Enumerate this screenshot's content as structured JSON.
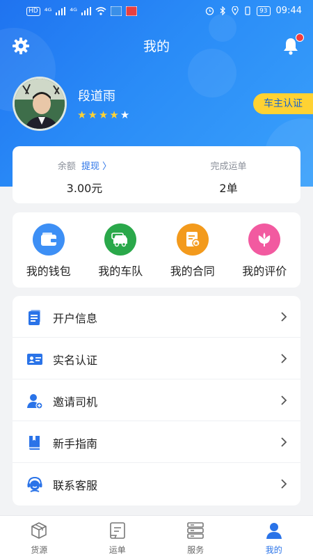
{
  "status_bar": {
    "network_chip": "HD",
    "signal_1": "⁴ᴳ",
    "signal_2": "⁴ᴳ",
    "battery": "93",
    "time": "09:44"
  },
  "header": {
    "title": "我的",
    "user_name": "段道雨",
    "rating_stars": 5,
    "verify_button": "车主认证"
  },
  "stats": {
    "balance_label": "余额",
    "withdraw_link": "提现 〉",
    "balance_value": "3.00元",
    "completed_label": "完成运单",
    "completed_value": "2单"
  },
  "quick_menu": [
    {
      "label": "我的钱包",
      "color": "#3d8ff5",
      "icon": "wallet-icon"
    },
    {
      "label": "我的车队",
      "color": "#2aa84a",
      "icon": "truck-icon"
    },
    {
      "label": "我的合同",
      "color": "#f39a1c",
      "icon": "contract-icon"
    },
    {
      "label": "我的评价",
      "color": "#f25aa0",
      "icon": "flower-icon"
    }
  ],
  "list": [
    {
      "label": "开户信息",
      "icon": "document-icon"
    },
    {
      "label": "实名认证",
      "icon": "id-card-icon"
    },
    {
      "label": "邀请司机",
      "icon": "invite-user-icon"
    },
    {
      "label": "新手指南",
      "icon": "book-icon"
    },
    {
      "label": "联系客服",
      "icon": "customer-service-icon"
    }
  ],
  "tabs": [
    {
      "label": "货源",
      "icon": "box-icon",
      "active": false
    },
    {
      "label": "运单",
      "icon": "waybill-icon",
      "active": false
    },
    {
      "label": "服务",
      "icon": "server-icon",
      "active": false
    },
    {
      "label": "我的",
      "icon": "person-icon",
      "active": true
    }
  ],
  "colors": {
    "primary": "#2a73e8",
    "header_gradient_start": "#1f73f0",
    "header_gradient_end": "#3aa1fb",
    "verify_bg": "#ffd233",
    "badge_red": "#f23d3d"
  }
}
